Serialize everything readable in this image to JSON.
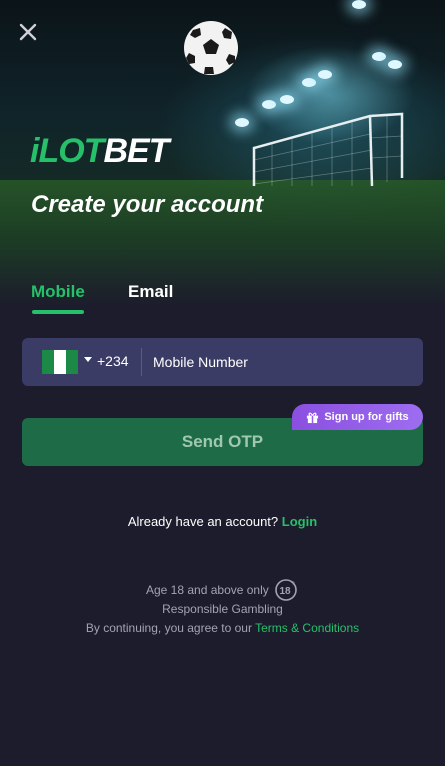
{
  "brand": {
    "logo_part1": "iLOT",
    "logo_part2": "BET",
    "accent": "#27c06a"
  },
  "header": {
    "close_icon": "close-icon",
    "title": "Create your account"
  },
  "tabs": [
    {
      "label": "Mobile",
      "active": true
    },
    {
      "label": "Email",
      "active": false
    }
  ],
  "phone": {
    "flag_icon": "nigeria-flag-icon",
    "dial_code": "+234",
    "placeholder": "Mobile Number",
    "value": ""
  },
  "gift_badge": {
    "icon": "gift-icon",
    "label": "Sign up for gifts"
  },
  "send_button": {
    "label": "Send OTP"
  },
  "login": {
    "prompt": "Already have an account?",
    "link": "Login"
  },
  "footer": {
    "age_text": "Age 18 and above only",
    "age_icon": "18-plus-icon",
    "responsible": "Responsible Gambling",
    "terms_prefix": "By continuing, you agree to our",
    "terms_link": "Terms & Conditions"
  }
}
